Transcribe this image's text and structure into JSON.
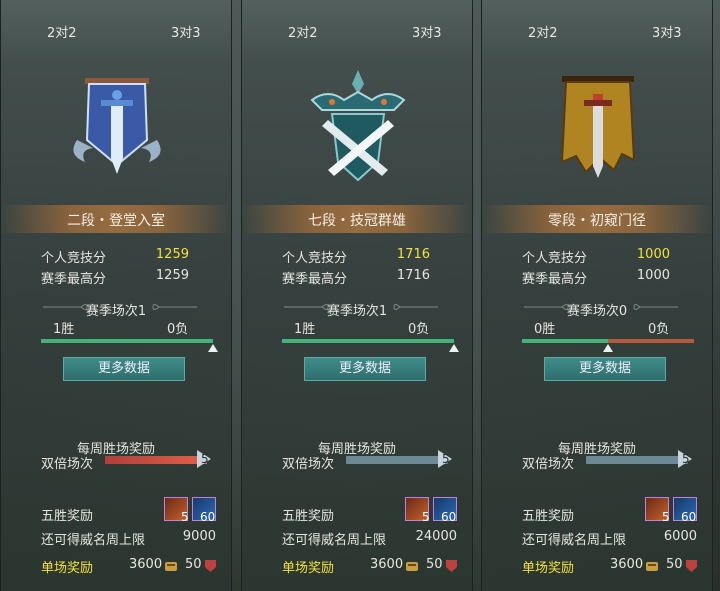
{
  "tabs": {
    "two_v_two": "2对2",
    "three_v_three": "3对3"
  },
  "labels": {
    "personal_score": "个人竞技分",
    "season_best": "赛季最高分",
    "more_data": "更多数据",
    "weekly_reward": "每周胜场奖励",
    "double_matches": "双倍场次",
    "five_win_reward": "五胜奖励",
    "cap_remaining": "还可得威名周上限",
    "per_match_reward": "单场奖励"
  },
  "panels": [
    {
      "rank_name": "二段・登堂入室",
      "personal_score": "1259",
      "season_best": "1259",
      "season_matches": "赛季场次1",
      "wins": "1胜",
      "losses": "0负",
      "win_fraction": 1.0,
      "double_count": "5",
      "double_fill_fraction": 1.0,
      "five_win_items": [
        {
          "icon": "chest-icon",
          "count": "5"
        },
        {
          "icon": "scroll-icon",
          "count": "60"
        }
      ],
      "cap_remaining": "9000",
      "per_match_coins": "3600",
      "per_match_gems": "50",
      "emblem": "blue-banner-sword-emblem"
    },
    {
      "rank_name": "七段・技冠群雄",
      "personal_score": "1716",
      "season_best": "1716",
      "season_matches": "赛季场次1",
      "wins": "1胜",
      "losses": "0负",
      "win_fraction": 1.0,
      "double_count": "5",
      "double_fill_fraction": 0.0,
      "five_win_items": [
        {
          "icon": "chest-icon",
          "count": "5"
        },
        {
          "icon": "scroll-icon",
          "count": "60"
        }
      ],
      "cap_remaining": "24000",
      "per_match_coins": "3600",
      "per_match_gems": "50",
      "emblem": "teal-crossed-swords-emblem"
    },
    {
      "rank_name": "零段・初窥门径",
      "personal_score": "1000",
      "season_best": "1000",
      "season_matches": "赛季场次0",
      "wins": "0胜",
      "losses": "0负",
      "win_fraction": 0.5,
      "double_count": "5",
      "double_fill_fraction": 0.0,
      "five_win_items": [
        {
          "icon": "chest-icon",
          "count": "5"
        },
        {
          "icon": "scroll-icon",
          "count": "60"
        }
      ],
      "cap_remaining": "6000",
      "per_match_coins": "3600",
      "per_match_gems": "50",
      "emblem": "gold-banner-sword-emblem"
    }
  ],
  "colors": {
    "score_highlight": "#f2e23a",
    "win_bar": "#44b37a",
    "loss_bar": "#b25a3a",
    "button": "#3f8c8a"
  }
}
